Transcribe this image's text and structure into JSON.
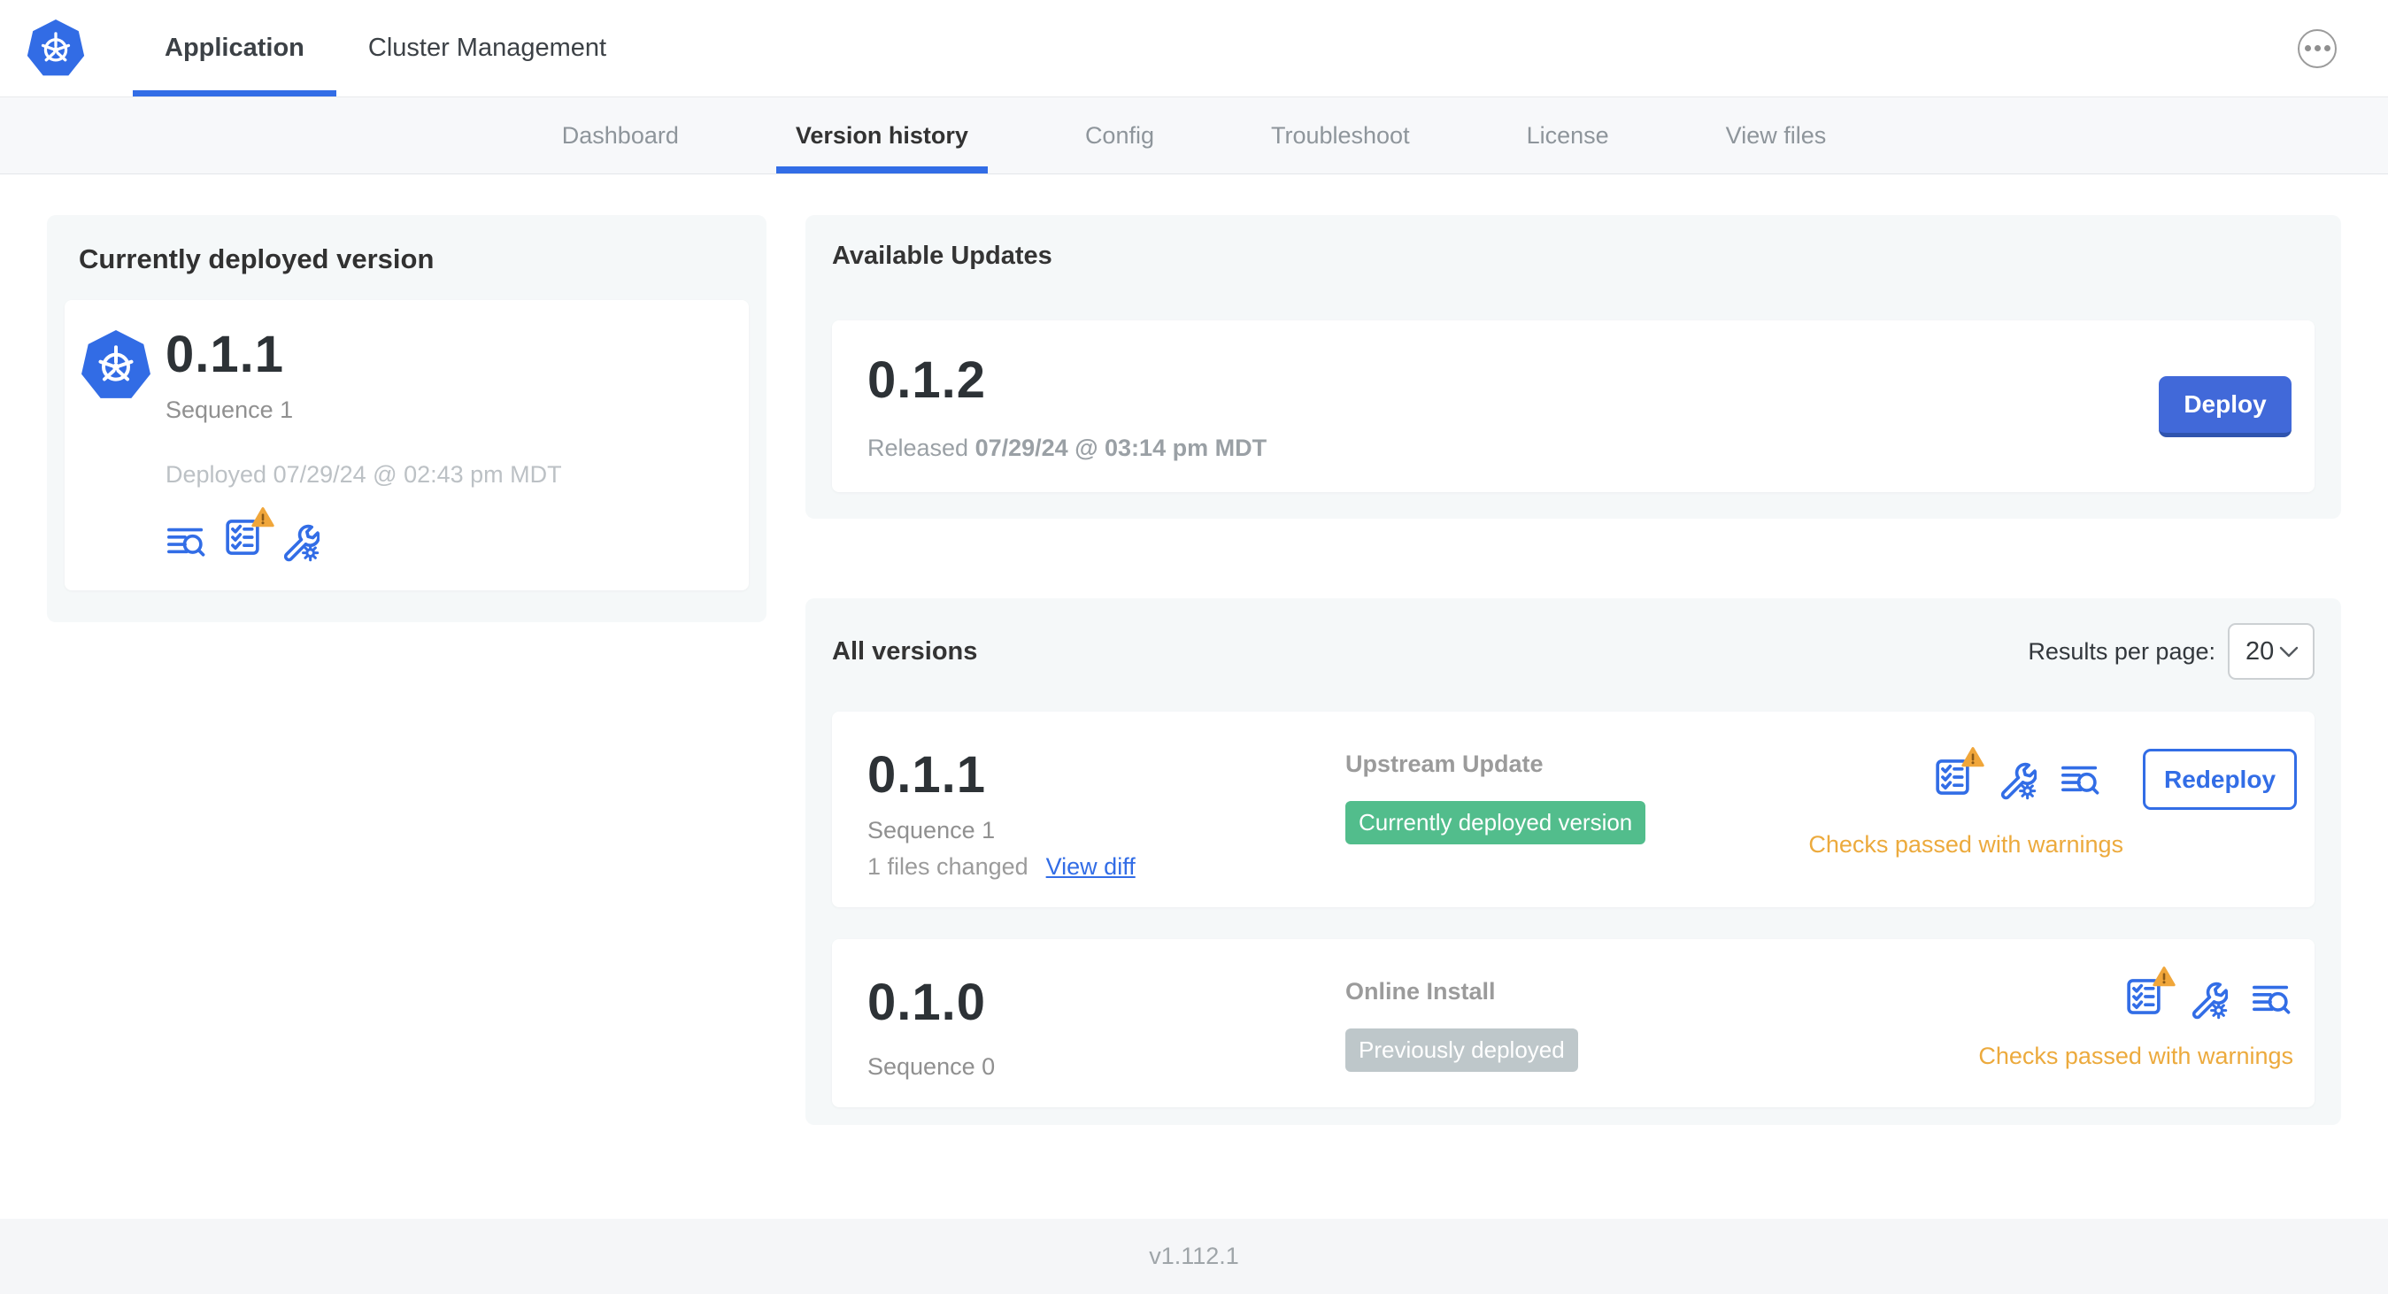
{
  "topbar": {
    "tabs": [
      {
        "label": "Application"
      },
      {
        "label": "Cluster Management"
      }
    ],
    "active_tab": "Application"
  },
  "subnav": {
    "tabs": [
      "Dashboard",
      "Version history",
      "Config",
      "Troubleshoot",
      "License",
      "View files"
    ],
    "active_tab": "Version history"
  },
  "current_version": {
    "title": "Currently deployed version",
    "version": "0.1.1",
    "sequence": "Sequence 1",
    "deployed": "Deployed 07/29/24 @ 02:43 pm MDT"
  },
  "available_updates": {
    "title": "Available Updates",
    "version": "0.1.2",
    "released_prefix": "Released",
    "released_date": "07/29/24 @ 03:14 pm MDT",
    "deploy_label": "Deploy"
  },
  "all_versions": {
    "title": "All versions",
    "results_per_page_label": "Results per page:",
    "results_per_page_value": "20",
    "rows": [
      {
        "version": "0.1.1",
        "sequence": "Sequence 1",
        "files_changed": "1 files changed",
        "view_diff_label": "View diff",
        "source": "Upstream Update",
        "badge": "Currently deployed version",
        "badge_color": "green",
        "status": "Checks passed with warnings",
        "action_label": "Redeploy"
      },
      {
        "version": "0.1.0",
        "sequence": "Sequence 0",
        "source": "Online Install",
        "badge": "Previously deployed",
        "badge_color": "gray",
        "status": "Checks passed with warnings"
      }
    ]
  },
  "footer": {
    "app_version": "v1.112.1"
  },
  "icons": {
    "brand": "kubernetes-logo",
    "row_icons": [
      "preflight-checks-icon",
      "config-wrench-icon",
      "view-logs-icon"
    ],
    "overflow": "ellipsis-icon",
    "warning": "warning-triangle-icon"
  },
  "colors": {
    "accent_blue": "#326de6",
    "deploy_blue": "#4169d9",
    "badge_green": "#52bd8c",
    "badge_gray": "#bec7ca",
    "warning_orange": "#ecaa3d",
    "card_bg": "#f5f8f9"
  }
}
